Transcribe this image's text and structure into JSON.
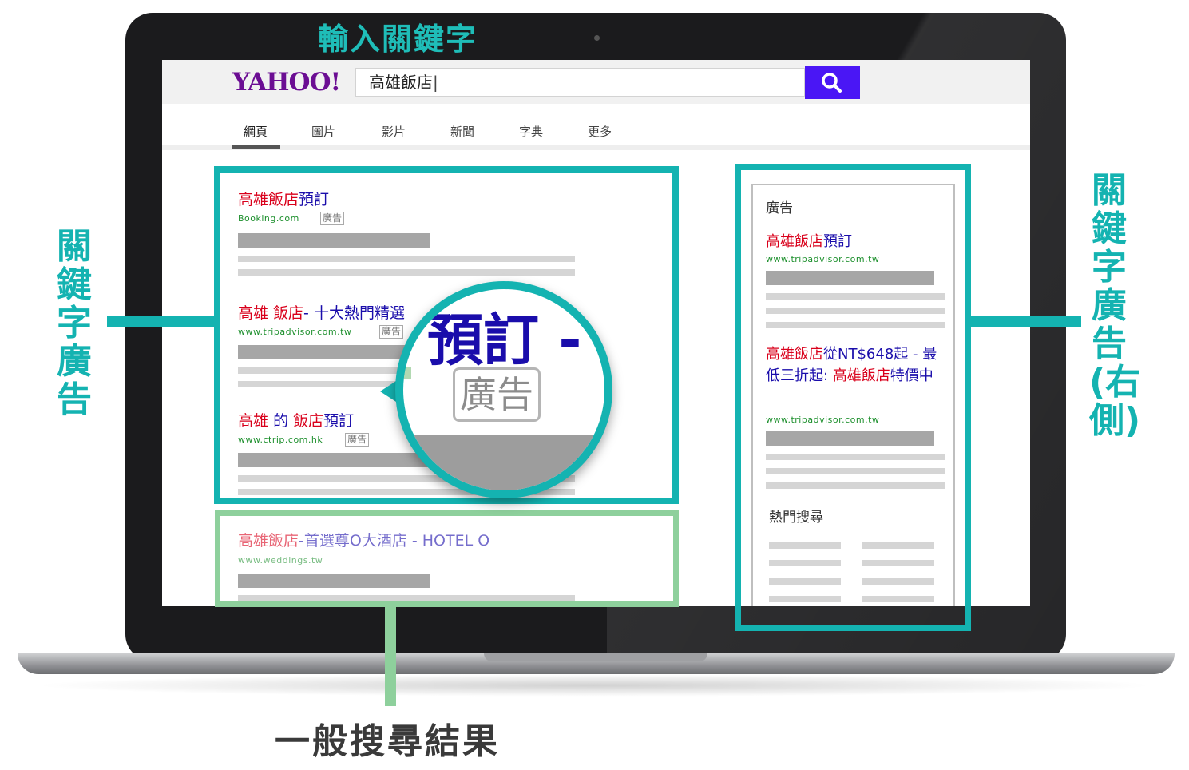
{
  "header_label": "輸入關鍵字",
  "left_label": "關鍵字廣告",
  "right_label": "關鍵字廣告(右側)",
  "bottom_label": "一般搜尋結果",
  "browser": {
    "logo": "YAHOO!",
    "search_value": "高雄飯店",
    "search_icon": "magnifier-icon",
    "tabs": [
      "網頁",
      "圖片",
      "影片",
      "新聞",
      "字典",
      "更多"
    ],
    "active_tab": "網頁"
  },
  "ad_results": [
    {
      "title_red": "高雄飯店",
      "title_blue": "預訂",
      "url": "Booking.com",
      "tag": "廣告"
    },
    {
      "title_red": "高雄 飯店",
      "title_blue": "- 十大熱門精選",
      "url": "www.tripadvisor.com.tw",
      "tag": "廣告"
    },
    {
      "title_red_a": "高雄",
      "title_blue_a": "的",
      "title_red_b": "飯店",
      "title_blue": "預訂",
      "url": "www.ctrip.com.hk",
      "tag": "廣告"
    }
  ],
  "magnifier": {
    "title": "預訂 -",
    "tag": "廣告"
  },
  "organic_result": {
    "title_red": "高雄飯店",
    "title_blue": "-首選尊O大酒店 - HOTEL O",
    "url": "www.weddings.tw"
  },
  "right_panel": {
    "heading": "廣告",
    "ad1": {
      "title_red": "高雄飯店",
      "title_blue": "預訂",
      "url": "www.tripadvisor.com.tw"
    },
    "ad2": {
      "title_red": "高雄飯店",
      "title_blue": "從NT$648起 - 最低三折起:",
      "title_red2": "高雄飯店",
      "title_blue2": "特價中",
      "url": "www.tripadvisor.com.tw"
    },
    "popular_heading": "熱門搜尋"
  },
  "colors": {
    "teal": "#14b3b1",
    "green": "#8ed09c",
    "yahoo_purple": "#6b0d93",
    "search_button": "#4a16f5",
    "ad_red": "#d9001b",
    "ad_blue": "#1a0dab"
  }
}
